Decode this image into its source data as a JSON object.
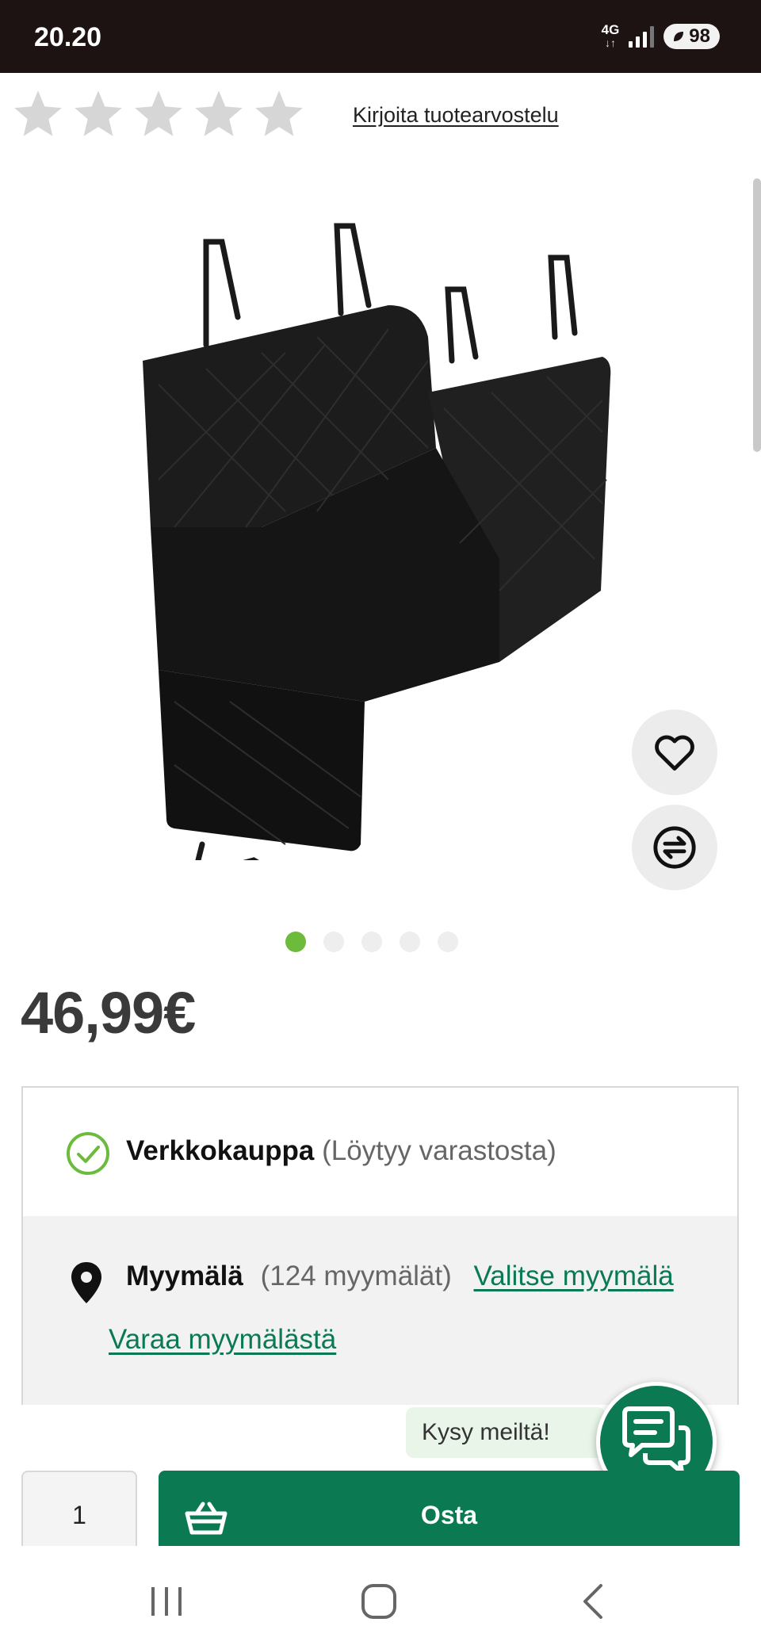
{
  "status_bar": {
    "time": "20.20",
    "network": "4G",
    "battery": "98"
  },
  "rating": {
    "stars_filled": 0,
    "stars_total": 5,
    "review_link": "Kirjoita tuotearvostelu"
  },
  "gallery": {
    "images_total": 5,
    "current_index": 1
  },
  "product": {
    "price": "46,99€"
  },
  "availability": {
    "online_label": "Verkkokauppa",
    "online_status": "(Löytyy varastosta)",
    "store_label": "Myymälä",
    "store_count": "(124 myymälät)",
    "choose_store_link": "Valitse myymälä",
    "reserve_link": "Varaa myymälästä"
  },
  "chat": {
    "label": "Kysy meiltä!"
  },
  "purchase": {
    "quantity": "1",
    "buy_label": "Osta"
  },
  "colors": {
    "brand_green": "#0b7a53",
    "check_green": "#6cbb3c",
    "status_bar": "#1e1313"
  }
}
